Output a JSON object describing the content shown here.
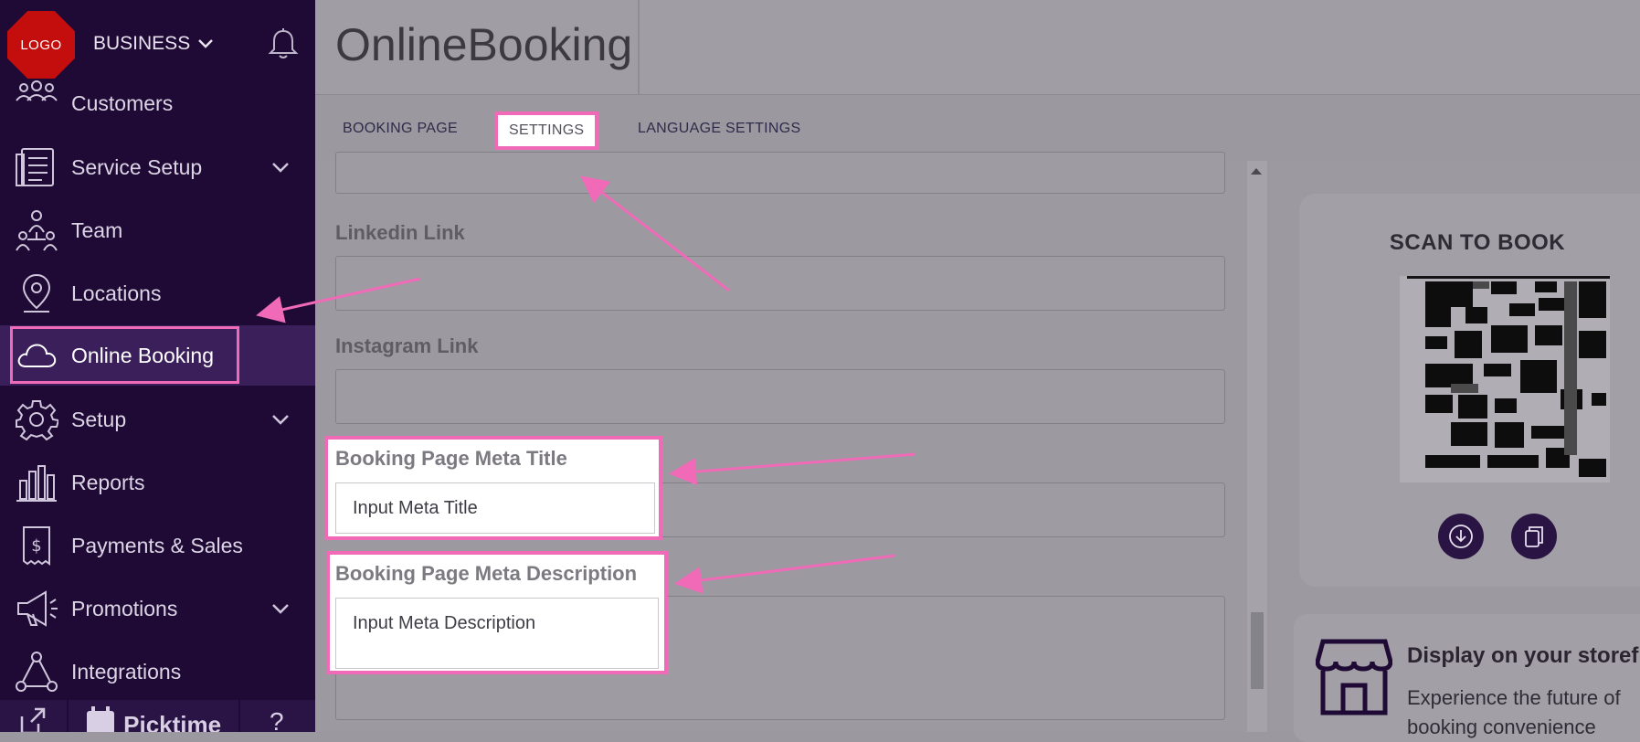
{
  "sidebar": {
    "logo_text": "LOGO",
    "business_label": "BUSINESS",
    "items": [
      {
        "label": "Customers",
        "icon": "customers-icon"
      },
      {
        "label": "Service Setup",
        "icon": "service-setup-icon",
        "has_chevron": true
      },
      {
        "label": "Team",
        "icon": "team-icon"
      },
      {
        "label": "Locations",
        "icon": "location-pin-icon"
      },
      {
        "label": "Online Booking",
        "icon": "cloud-icon",
        "active": true
      },
      {
        "label": "Setup",
        "icon": "gear-icon",
        "has_chevron": true
      },
      {
        "label": "Reports",
        "icon": "bar-chart-icon"
      },
      {
        "label": "Payments & Sales",
        "icon": "receipt-dollar-icon"
      },
      {
        "label": "Promotions",
        "icon": "megaphone-icon",
        "has_chevron": true
      },
      {
        "label": "Integrations",
        "icon": "integrations-icon"
      }
    ],
    "footer_brand": "Picktime",
    "help_label": "?"
  },
  "header": {
    "title": "OnlineBooking"
  },
  "tabs": [
    {
      "label": "BOOKING PAGE",
      "active": false
    },
    {
      "label": "SETTINGS",
      "active": true
    },
    {
      "label": "LANGUAGE SETTINGS",
      "active": false
    }
  ],
  "form": {
    "linkedin_label": "Linkedin Link",
    "instagram_label": "Instagram Link",
    "meta_title_label": "Booking Page Meta Title",
    "meta_title_placeholder": "Input Meta Title",
    "meta_description_label": "Booking Page Meta Description",
    "meta_description_placeholder": "Input Meta Description"
  },
  "right_panel": {
    "scan_title": "SCAN TO BOOK",
    "download_icon": "download-icon",
    "copy_icon": "copy-icon",
    "store_title": "Display on your storefront",
    "store_desc_line1": "Experience the future of",
    "store_desc_line2": "booking convenience"
  },
  "colors": {
    "sidebar_bg": "#1f0a35",
    "highlight": "#f06ab8",
    "logo_red": "#c40d0d",
    "dim_overlay": "#9b999f"
  }
}
